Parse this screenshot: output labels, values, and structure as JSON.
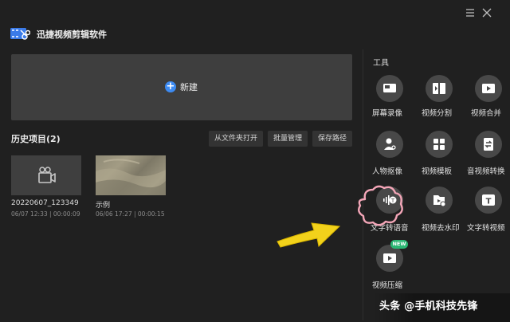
{
  "app": {
    "title": "迅捷视频剪辑软件",
    "logo_icon": "film-scissors-logo-icon"
  },
  "window_controls": {
    "menu_icon": "hamburger-menu-icon",
    "close_icon": "close-icon"
  },
  "new_project": {
    "label": "新建",
    "icon": "plus-circle-icon",
    "accent": "#3d8bf2"
  },
  "history": {
    "title": "历史项目(2)",
    "buttons": [
      "从文件夹打开",
      "批量管理",
      "保存路径"
    ],
    "projects": [
      {
        "name": "20220607_123349",
        "meta": "06/07 12:33 | 00:00:09",
        "thumb_icon": "video-camera-icon"
      },
      {
        "name": "示例",
        "meta": "06/06 17:27 | 00:00:15",
        "thumb_icon": "sand-dunes-thumbnail"
      }
    ]
  },
  "tools": {
    "title": "工具",
    "items": [
      {
        "label": "屏幕录像",
        "icon": "screen-record-icon"
      },
      {
        "label": "视频分割",
        "icon": "video-split-icon"
      },
      {
        "label": "视频合并",
        "icon": "video-merge-icon"
      },
      {
        "label": "人物抠像",
        "icon": "person-cutout-icon"
      },
      {
        "label": "视频模板",
        "icon": "video-template-icon"
      },
      {
        "label": "音视频转换",
        "icon": "av-convert-icon"
      },
      {
        "label": "文字转语音",
        "icon": "text-to-speech-icon"
      },
      {
        "label": "视频去水印",
        "icon": "remove-watermark-icon"
      },
      {
        "label": "文字转视频",
        "icon": "text-to-video-icon"
      },
      {
        "label": "视频压缩",
        "icon": "video-compress-icon",
        "badge": "NEW"
      }
    ],
    "badge_color": "#2bb673"
  },
  "annotations": {
    "highlight_icon": "pink-cloud-highlight",
    "arrow_icon": "yellow-arrow-icon",
    "arrow_color": "#f2d21b",
    "cloud_color": "#f4a6b8"
  },
  "watermark": {
    "text": "头条 @手机科技先锋"
  }
}
